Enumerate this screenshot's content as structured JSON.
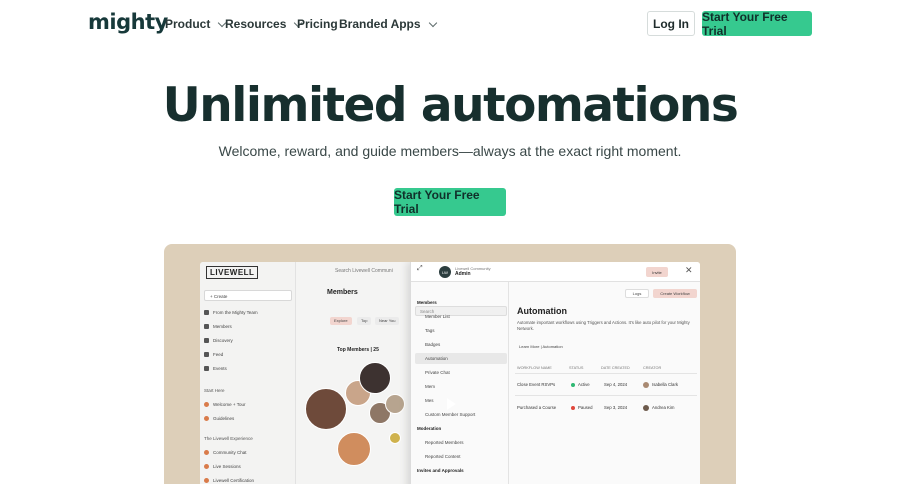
{
  "nav": {
    "logo": "mighty",
    "items": [
      {
        "label": "Product",
        "dropdown": true
      },
      {
        "label": "Resources",
        "dropdown": true
      },
      {
        "label": "Pricing",
        "dropdown": false
      },
      {
        "label": "Branded Apps",
        "dropdown": true
      }
    ],
    "login": "Log In",
    "cta": "Start Your Free Trial"
  },
  "hero": {
    "title": "Unlimited automations",
    "subtitle": "Welcome, reward, and guide members—always at the exact right moment.",
    "cta": "Start Your Free Trial"
  },
  "colors": {
    "accent": "#36c98f",
    "title": "#172f2e",
    "frame": "#ddcfb9"
  },
  "product_shot": {
    "brand": "LIVEWELL",
    "search": "Search Livewell Communi",
    "left_nav": {
      "create": "+ Create",
      "from_team": "From the Mighty Team",
      "items": [
        "Members",
        "Discovery",
        "Feed",
        "Events"
      ],
      "start_here": "Start Here",
      "start_items": [
        "Welcome + Tour",
        "Guidelines"
      ],
      "experience": "The Livewell Experience",
      "experience_items": [
        "Community Chat",
        "Live Sessions",
        "Livewell Certification"
      ]
    },
    "middle": {
      "title": "Members",
      "chips": [
        "Explore",
        "Top",
        "Near You"
      ],
      "top_members": "Top Members | 25"
    },
    "modal": {
      "community": "Livewell Community",
      "admin": "Admin",
      "invite": "Invite",
      "search": "Search",
      "groups": [
        {
          "label": "Members",
          "items": [
            "Member List",
            "Tags",
            "Badges",
            "Automation",
            "Private Chat",
            "Mem",
            "Mes",
            "Custom Member Support"
          ]
        },
        {
          "label": "Moderation",
          "items": [
            "Reported Members",
            "Reported Content"
          ]
        },
        {
          "label": "Invites and Approvals",
          "items": []
        }
      ],
      "active_item": "Automation",
      "logs": "Logs",
      "create_workflow": "Create Workflow",
      "heading": "Automation",
      "description": "Automate important workflows using Triggers and Actions. It's like auto pilot for your Mighty Network.",
      "learn_more": "Learn More | Automation",
      "table": {
        "headers": [
          "WORKFLOW NAME",
          "STATUS",
          "DATE CREATED",
          "CREATOR"
        ],
        "rows": [
          {
            "name": "Close Event RSVPs",
            "status": "Active",
            "status_color": "#2fb873",
            "date": "Sep 4, 2024",
            "creator": "Isabella Clark"
          },
          {
            "name": "Purchased a Course",
            "status": "Paused",
            "status_color": "#e0473c",
            "date": "Sep 3, 2024",
            "creator": "Andrea Kim"
          }
        ]
      }
    }
  }
}
